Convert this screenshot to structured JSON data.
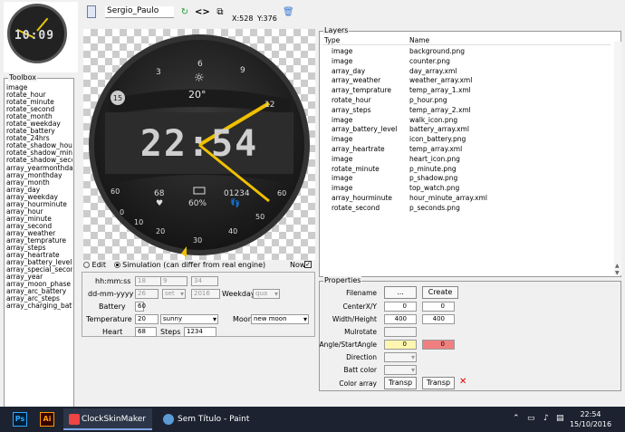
{
  "preview": {
    "time": "10:09"
  },
  "toolbox": {
    "title": "Toolbox",
    "items": [
      "image",
      "rotate_hour",
      "rotate_minute",
      "rotate_second",
      "rotate_month",
      "rotate_weekday",
      "rotate_battery",
      "rotate_24hrs",
      "rotate_shadow_hour",
      "rotate_shadow_minute",
      "rotate_shadow_second",
      "array_yearmonthday",
      "array_monthday",
      "array_month",
      "array_day",
      "array_weekday",
      "array_hourminute",
      "array_hour",
      "array_minute",
      "array_second",
      "array_weather",
      "array_temprature",
      "array_steps",
      "array_heartrate",
      "array_battery_level",
      "array_special_second",
      "array_year",
      "array_moon_phase",
      "array_arc_battery",
      "array_arc_steps",
      "array_charging_batt"
    ]
  },
  "topbar": {
    "filename": "Sergio_Paulo",
    "x": "X:528",
    "y": "Y:376",
    "refresh_icon": "refresh-icon",
    "code_icon": "<>",
    "copy_icon": "copy-icon",
    "delete_icon": "trash-icon"
  },
  "watch": {
    "time": "22:54",
    "dial_numbers": [
      "3",
      "6",
      "9",
      "12"
    ],
    "badge": "15",
    "temp": "20°",
    "steps": "01234",
    "battery": "60%",
    "heart": "68",
    "scale": [
      "60",
      "0",
      "10",
      "20",
      "30",
      "40",
      "50",
      "60"
    ],
    "accent": "#f0c000"
  },
  "sim": {
    "edit_label": "Edit",
    "sim_label": "Simulation (can differ from real engine)",
    "now_label": "Now",
    "hhmmss_label": "hh:mm:ss",
    "h": "18",
    "m": "9",
    "s": "34",
    "date_label": "dd-mm-yyyy",
    "d": "26",
    "mo": "set",
    "y": "2016",
    "weekday_label": "Weekday",
    "weekday": "qua",
    "battery_label": "Battery",
    "battery": "60",
    "temp_label": "Temperature",
    "temp": "20",
    "weather": "sunny",
    "moon_label": "Moon",
    "moon": "new moon",
    "heart_label": "Heart",
    "heart": "68",
    "steps_label": "Steps",
    "steps": "1234"
  },
  "layers": {
    "title": "Layers",
    "col_type": "Type",
    "col_name": "Name",
    "rows": [
      [
        "image",
        "background.png"
      ],
      [
        "image",
        "counter.png"
      ],
      [
        "array_day",
        "day_array.xml"
      ],
      [
        "array_weather",
        "weather_array.xml"
      ],
      [
        "array_temprature",
        "temp_array_1.xml"
      ],
      [
        "rotate_hour",
        "p_hour.png"
      ],
      [
        "array_steps",
        "temp_array_2.xml"
      ],
      [
        "image",
        "walk_icon.png"
      ],
      [
        "array_battery_level",
        "battery_array.xml"
      ],
      [
        "image",
        "icon_battery.png"
      ],
      [
        "array_heartrate",
        "temp_array.xml"
      ],
      [
        "image",
        "heart_icon.png"
      ],
      [
        "rotate_minute",
        "p_minute.png"
      ],
      [
        "image",
        "p_shadow.png"
      ],
      [
        "image",
        "top_watch.png"
      ],
      [
        "array_hourminute",
        "hour_minute_array.xml"
      ],
      [
        "rotate_second",
        "p_seconds.png"
      ]
    ]
  },
  "props": {
    "title": "Properties",
    "filename_label": "Filename",
    "browse": "...",
    "create": "Create",
    "center_label": "CenterX/Y",
    "cx": "0",
    "cy": "0",
    "wh_label": "Width/Height",
    "w": "400",
    "h": "400",
    "mul_label": "Mulrotate",
    "angle_label": "Angle/StartAngle",
    "angle": "0",
    "start": "0",
    "dir_label": "Direction",
    "batt_label": "Batt color",
    "color_label": "Color array",
    "transp1": "Transp",
    "transp2": "Transp"
  },
  "taskbar": {
    "app1": "ClockSkinMaker",
    "app2": "Sem Título - Paint",
    "time": "22:54",
    "date": "15/10/2016"
  }
}
